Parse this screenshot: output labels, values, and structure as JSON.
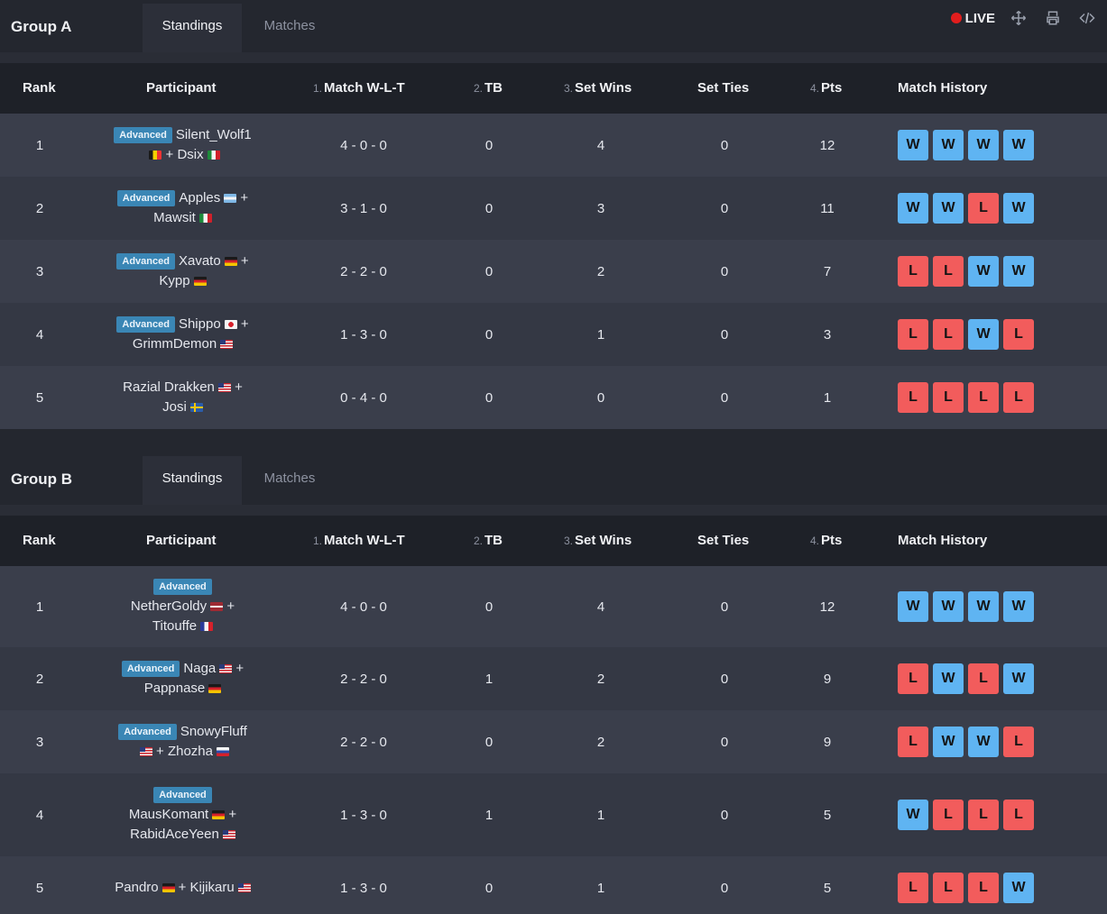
{
  "toolbar": {
    "live_label": "LIVE",
    "icons": [
      "move-icon",
      "print-icon",
      "embed-code-icon"
    ]
  },
  "tabs": {
    "standings": "Standings",
    "matches": "Matches"
  },
  "columns": {
    "rank": "Rank",
    "participant": "Participant",
    "wlt_num": "1.",
    "wlt": "Match W-L-T",
    "tb_num": "2.",
    "tb": "TB",
    "sw_num": "3.",
    "sw": "Set Wins",
    "set_ties": "Set Ties",
    "pts_num": "4.",
    "pts": "Pts",
    "history": "Match History"
  },
  "badge_label": "Advanced",
  "groups": [
    {
      "title": "Group A",
      "rows": [
        {
          "rank": "1",
          "line1": "Silent_Wolf1",
          "line2": "+ Dsix",
          "wlt": "4 - 0 - 0",
          "tb": "0",
          "sw": "4",
          "st": "0",
          "pts": "12",
          "history": [
            "W",
            "W",
            "W",
            "W"
          ]
        },
        {
          "rank": "2",
          "line1": "Apples",
          "line2": "Mawsit",
          "wlt": "3 - 1 - 0",
          "tb": "0",
          "sw": "3",
          "st": "0",
          "pts": "11",
          "history": [
            "W",
            "W",
            "L",
            "W"
          ]
        },
        {
          "rank": "3",
          "line1": "Xavato",
          "line2": "Kypp",
          "wlt": "2 - 2 - 0",
          "tb": "0",
          "sw": "2",
          "st": "0",
          "pts": "7",
          "history": [
            "L",
            "L",
            "W",
            "W"
          ]
        },
        {
          "rank": "4",
          "line1": "Shippo",
          "line2": "GrimmDemon",
          "wlt": "1 - 3 - 0",
          "tb": "0",
          "sw": "1",
          "st": "0",
          "pts": "3",
          "history": [
            "L",
            "L",
            "W",
            "L"
          ]
        },
        {
          "rank": "5",
          "line1": "Razial Drakken",
          "line2": "Josi",
          "wlt": "0 - 4 - 0",
          "tb": "0",
          "sw": "0",
          "st": "0",
          "pts": "1",
          "history": [
            "L",
            "L",
            "L",
            "L"
          ]
        }
      ]
    },
    {
      "title": "Group B",
      "rows": [
        {
          "rank": "1",
          "line1": "NetherGoldy",
          "line2": "Titouffe",
          "wlt": "4 - 0 - 0",
          "tb": "0",
          "sw": "4",
          "st": "0",
          "pts": "12",
          "history": [
            "W",
            "W",
            "W",
            "W"
          ]
        },
        {
          "rank": "2",
          "line1": "Naga",
          "line2": "Pappnase",
          "wlt": "2 - 2 - 0",
          "tb": "1",
          "sw": "2",
          "st": "0",
          "pts": "9",
          "history": [
            "L",
            "W",
            "L",
            "W"
          ]
        },
        {
          "rank": "3",
          "line1": "SnowyFluff",
          "line2": "+ Zhozha",
          "wlt": "2 - 2 - 0",
          "tb": "0",
          "sw": "2",
          "st": "0",
          "pts": "9",
          "history": [
            "L",
            "W",
            "W",
            "L"
          ]
        },
        {
          "rank": "4",
          "line1": "MausKomant",
          "line2": "RabidAceYeen",
          "wlt": "1 - 3 - 0",
          "tb": "1",
          "sw": "1",
          "st": "0",
          "pts": "5",
          "history": [
            "W",
            "L",
            "L",
            "L"
          ]
        },
        {
          "rank": "5",
          "line1": "Pandro",
          "line2": "+ Kijikaru",
          "wlt": "1 - 3 - 0",
          "tb": "0",
          "sw": "1",
          "st": "0",
          "pts": "5",
          "history": [
            "L",
            "L",
            "L",
            "W"
          ]
        }
      ]
    }
  ],
  "plus": "+"
}
